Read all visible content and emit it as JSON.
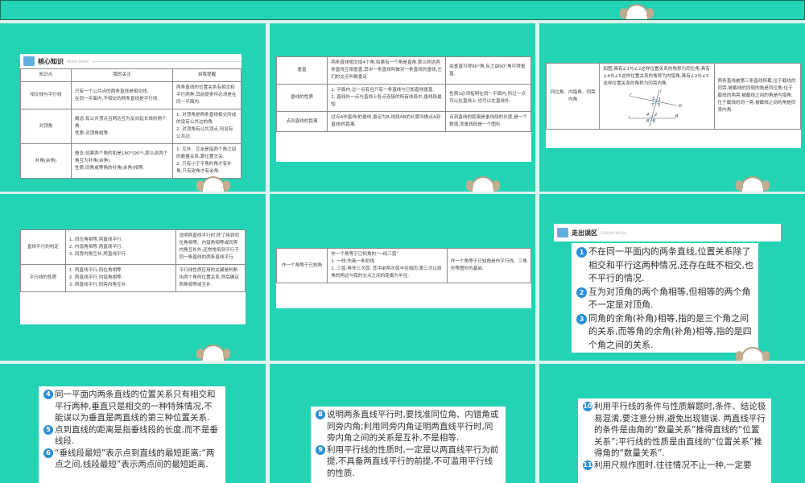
{
  "colors": {
    "panel": "#23d4b4",
    "number_badge": "#2a8fd6"
  },
  "core_header": {
    "title": "核心知识",
    "pinyin": "HEXIN ZHISHI"
  },
  "mistakes_header": {
    "title": "走出误区",
    "pinyin": "ZOUCHU WUQU"
  },
  "tables": [
    {
      "header": [
        "知识点",
        "我的关注",
        "自我提醒"
      ],
      "rows": [
        [
          "相交线与平行线",
          "只有一个公共点的两条直线是相交线.\n在同一平面内,不相交的两条直线是平行线.",
          "两条直线的位置关系有相交和平行两种,其前提条件必须是在同一平面内."
        ],
        [
          "对顶角",
          "概念:有公共顶点且两边互为反向延长线的两个角.\n性质:对顶角相等.",
          "1. 对顶角是两条直线相交所成的没有公共边的角.\n2. 对顶角有公共顶点,但没有公共边."
        ],
        [
          "补角(余角)",
          "概念:如果两个角的和是180°(90°),那么这两个角互为补角(余角).\n性质:同角或等角的补角(余角)相等.",
          "1. 互补、互余是指两个角之间的数量关系,跟位置无关.\n2. 只有小于平角的角才有补角,只有锐角才有余角."
        ]
      ]
    },
    {
      "rows": [
        [
          "垂直",
          "两条直线相交成4个角,如果有一个角是直角,那么称这两条直线互相垂直,其中一条直线叫做另一条直线的垂线,它们的交点叫做垂足.",
          "由垂直可得90°角,反之由90°角可得垂直."
        ],
        [
          "垂线的性质",
          "1. 平面内,过一点有且只有一条直线与已知直线垂直.\n2. 直线外一点与直线上各点连接的所有线段中,垂线段最短.",
          "性质1必须指明在同一平面内,所过一点可以在直线上,也可以在直线外."
        ],
        [
          "点到直线的距离",
          "过点A作直线l的垂线,垂足为B,线段AB的长度叫做点A到直线l的距离.",
          "点到直线的距离是垂线段的长度,是一个数值,而垂线段是一个图形."
        ]
      ]
    },
    {
      "rows": [
        [
          "同位角、内错角、同旁内角",
          "如图,具有∠1与∠2这样位置关系的角称为同位角,具有∠4与∠5这样位置关系的角称为内错角,具有∠2与∠5这样位置关系的角称为同旁内角.",
          "两条直线被第三条直线所截,位于截线的同旁,被截线的同侧的角是同位角;位于截线的两旁,被截线之间的角是内错角;位于截线的同一旁,被截线之间的角是同旁内角."
        ]
      ]
    },
    {
      "rows": [
        [
          "直线平行的判定",
          "1. 同位角相等,两直线平行.\n2. 内错角相等,两直线平行.\n3. 同旁内角互补,两直线平行.",
          "说明两直线平行时,除了用到同位角相等、内错角相等或同旁内角互补外,还常常用到平行于同一条直线的两条直线平行."
        ],
        [
          "平行线的性质",
          "1. 两直线平行,同位角相等.\n2. 两直线平行,内错角相等.\n3. 两直线平行,同旁内角互补.",
          "平行线性质应用的关键是判断出两个角的位置关系,然后确定两角相等或互补."
        ]
      ]
    },
    {
      "rows": [
        [
          "作一个角等于已知角",
          "作一个角等于已知角的“一线三弧”\n1. 一线:先画一条射线.\n2. 三弧:再作三次弧. 其中前两次弧半径相同,第三次以原角的两边与弧的交点之间的距离为半径.",
          "作一个角等于已知角是作平行线、三角形等图形的基础."
        ]
      ]
    }
  ],
  "figure": {
    "C": "C",
    "D": "D",
    "A": "A",
    "B": "B",
    "l": "l",
    "a1": "1",
    "a2": "2",
    "a3": "3",
    "a4": "4",
    "a5": "5",
    "a6": "6",
    "a7": "7",
    "a8": "8"
  },
  "notes": [
    [
      {
        "n": "1",
        "t": "不在同一平面内的两条直线,位置关系除了相交和平行这两种情况,还存在既不相交,也不平行的情况."
      },
      {
        "n": "2",
        "t": "互为对顶角的两个角相等,但相等的两个角不一定是对顶角."
      },
      {
        "n": "3",
        "t": "同角的余角(补角)相等,指的是三个角之间的关系,而等角的余角(补角)相等,指的是四个角之间的关系."
      }
    ],
    [
      {
        "n": "4",
        "t": "同一平面内两条直线的位置关系只有相交和平行两种,垂直只是相交的一种特殊情况,不能误以为垂直是两直线的第三种位置关系."
      },
      {
        "n": "5",
        "t": "点到直线的距离是指垂线段的长度,而不是垂线段."
      },
      {
        "n": "6",
        "t": "“垂线段最短”表示点到直线的最短距离;“两点之间,线段最短”表示两点间的最短距离."
      }
    ],
    [
      {
        "n": "8",
        "t": "说明两条直线平行时,要找准同位角、内错角或同旁内角;利用同旁内角证明两直线平行时,同旁内角之间的关系是互补,不是相等."
      },
      {
        "n": "9",
        "t": "利用平行线的性质时,一定是以两直线平行为前提,不具备两直线平行的前提,不可滥用平行线的性质."
      }
    ],
    [
      {
        "n": "10",
        "t": "利用平行线的条件与性质解题时,条件、结论极易混淆,要注意分辨,避免出现错误. 两直线平行的条件是由角的“数量关系”推得直线的“位置关系”;平行线的性质是由直线的“位置关系”推得角的“数量关系”."
      },
      {
        "n": "11",
        "t": "利用尺规作图时,往往情况不止一种,一定要"
      }
    ]
  ]
}
